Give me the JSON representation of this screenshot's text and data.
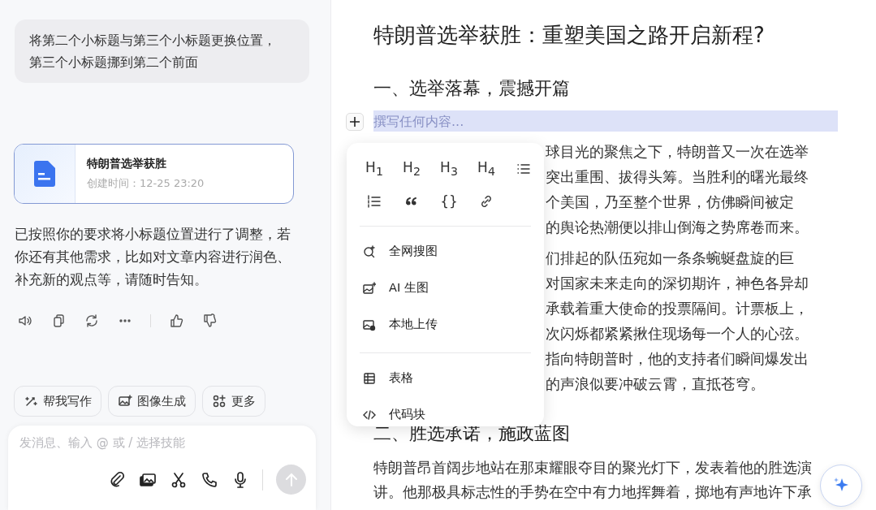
{
  "chat": {
    "user_message": "将第二个小标题与第三个小标题更换位置，第三个小标题挪到第二个前面",
    "document_card": {
      "title": "特朗普选举获胜",
      "created": "创建时间：12-25 23:20"
    },
    "reply": "已按照你的要求将小标题位置进行了调整，若你还有其他需求，比如对文章内容进行润色、补充新的观点等，请随时告知。",
    "actions": [
      {
        "kind": "speaker"
      },
      {
        "kind": "copy"
      },
      {
        "kind": "regenerate"
      },
      {
        "kind": "more"
      },
      {
        "kind": "divider"
      },
      {
        "kind": "like"
      },
      {
        "kind": "dislike"
      }
    ],
    "chips": [
      {
        "kind": "write",
        "label": "帮我写作"
      },
      {
        "kind": "image",
        "label": "图像生成"
      },
      {
        "kind": "more",
        "label": "更多"
      }
    ],
    "input": {
      "placeholder": "发消息、输入 @ 或 / 选择技能",
      "tools": [
        {
          "kind": "attach"
        },
        {
          "kind": "images"
        },
        {
          "kind": "scissors"
        },
        {
          "kind": "phone"
        },
        {
          "kind": "mic"
        }
      ],
      "send_disabled": true
    }
  },
  "document": {
    "title": "特朗普选举获胜：重塑美国之路开启新程?",
    "heading_1": "一、选举落幕，震撼开篇",
    "placeholder": "撰写任何内容...",
    "paragraph_1_lines": [
      "球目光的聚焦之下，特朗普又一次在选举",
      "突出重围、拔得头筹。当胜利的曙光最终",
      "个美国，乃至整个世界，仿佛瞬间被定",
      "的舆论热潮便以排山倒海之势席卷而来。"
    ],
    "paragraph_2_lines": [
      "们排起的队伍宛如一条条蜿蜒盘旋的巨",
      "对国家未来走向的深切期许，神色各异却",
      "承载着重大使命的投票隔间。计票板上，",
      "次闪烁都紧紧揪住现场每一个人的心弦。",
      "指向特朗普时，他的支持者们瞬间爆发出",
      "的声浪似要冲破云霄，直抵苍穹。"
    ],
    "heading_2": "二、胜选承诺，施政蓝图",
    "paragraph_3": "特朗普昂首阔步地站在那束耀眼夺目的聚光灯下，发表着他的胜选演讲。他那极具标志性的手势在空中有力地挥舞着，掷地有声地许下承"
  },
  "insert_menu": {
    "format_buttons": [
      {
        "kind": "heading",
        "label": "H$_{1}$"
      },
      {
        "kind": "heading",
        "label": "H$_{2}$"
      },
      {
        "kind": "heading",
        "label": "H$_{3}$"
      },
      {
        "kind": "heading",
        "label": "H$_{4}$"
      },
      {
        "kind": "bullet-list"
      },
      {
        "kind": "ordered-list"
      },
      {
        "kind": "quote"
      },
      {
        "kind": "code",
        "label": "{}"
      },
      {
        "kind": "link"
      }
    ],
    "groups": [
      [
        {
          "kind": "search-image",
          "label": "全网搜图"
        },
        {
          "kind": "ai-image",
          "label": "AI 生图"
        },
        {
          "kind": "upload",
          "label": "本地上传"
        }
      ],
      [
        {
          "kind": "table",
          "label": "表格"
        },
        {
          "kind": "code-block",
          "label": "代码块"
        }
      ]
    ]
  }
}
